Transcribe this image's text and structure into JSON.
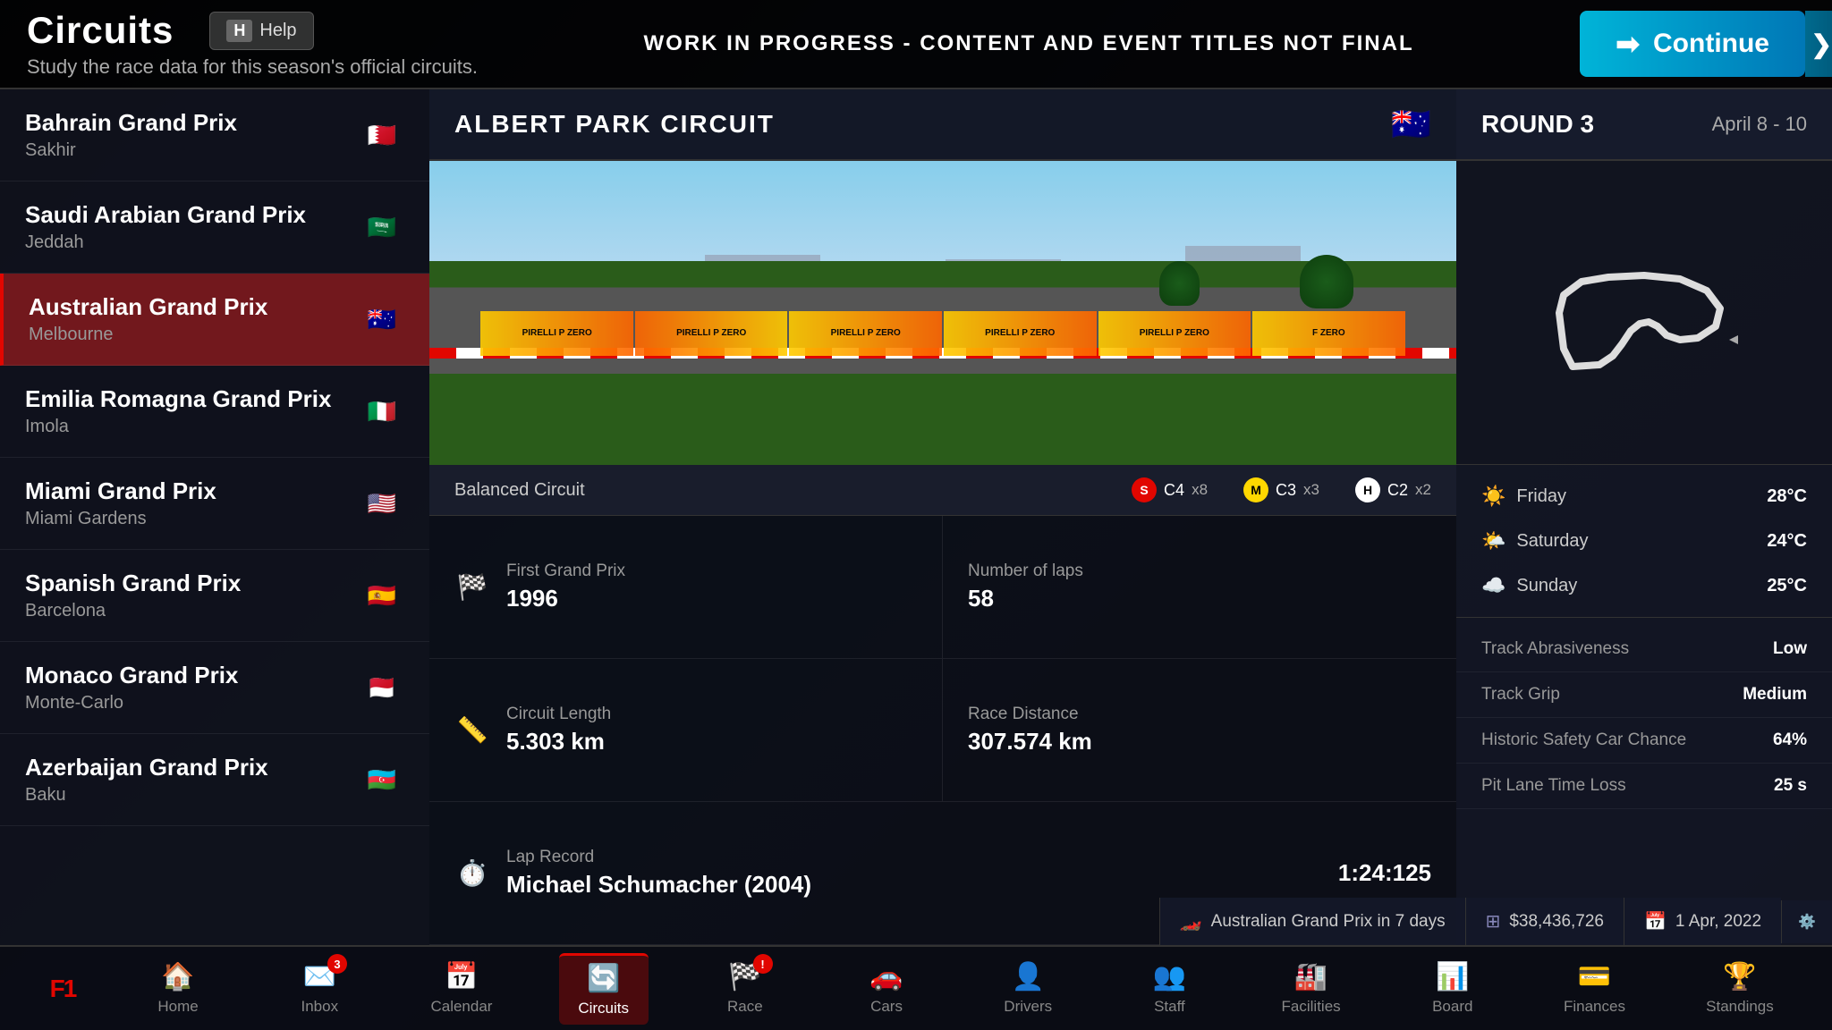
{
  "app": {
    "wip_banner": "WORK IN PROGRESS - CONTENT AND EVENT TITLES NOT FINAL"
  },
  "header": {
    "title": "Circuits",
    "subtitle": "Study the race data for this season's official circuits.",
    "help_label": "Help",
    "help_key": "H",
    "continue_label": "Continue"
  },
  "race_list": [
    {
      "id": "bahrain",
      "name": "Bahrain Grand Prix",
      "city": "Sakhir",
      "flag": "🇧🇭",
      "active": false
    },
    {
      "id": "saudi",
      "name": "Saudi Arabian Grand Prix",
      "city": "Jeddah",
      "flag": "🇸🇦",
      "active": false
    },
    {
      "id": "australia",
      "name": "Australian Grand Prix",
      "city": "Melbourne",
      "flag": "🇦🇺",
      "active": true
    },
    {
      "id": "emilia",
      "name": "Emilia Romagna Grand Prix",
      "city": "Imola",
      "flag": "🇮🇹",
      "active": false
    },
    {
      "id": "miami",
      "name": "Miami Grand Prix",
      "city": "Miami Gardens",
      "flag": "🇺🇸",
      "active": false
    },
    {
      "id": "spanish",
      "name": "Spanish Grand Prix",
      "city": "Barcelona",
      "flag": "🇪🇸",
      "active": false
    },
    {
      "id": "monaco",
      "name": "Monaco Grand Prix",
      "city": "Monte-Carlo",
      "flag": "🇲🇨",
      "active": false
    },
    {
      "id": "azerbaijan",
      "name": "Azerbaijan Grand Prix",
      "city": "Baku",
      "flag": "🇦🇿",
      "active": false
    }
  ],
  "circuit_detail": {
    "name": "ALBERT PARK CIRCUIT",
    "flag": "🇦🇺",
    "type": "Balanced Circuit",
    "tyres": {
      "soft": {
        "label": "S",
        "compound": "C4",
        "count": "x8"
      },
      "medium": {
        "label": "M",
        "compound": "C3",
        "count": "x3"
      },
      "hard": {
        "label": "H",
        "compound": "C2",
        "count": "x2"
      }
    },
    "first_grand_prix_label": "First Grand Prix",
    "first_grand_prix_value": "1996",
    "laps_label": "Number of laps",
    "laps_value": "58",
    "length_label": "Circuit Length",
    "length_value": "5.303 km",
    "distance_label": "Race Distance",
    "distance_value": "307.574 km",
    "lap_record_label": "Lap Record",
    "lap_record_holder": "Michael Schumacher (2004)",
    "lap_record_time": "1:24:125"
  },
  "round_info": {
    "label": "ROUND 3",
    "dates": "April 8 - 10"
  },
  "weather": [
    {
      "day": "Friday",
      "icon": "☀️",
      "temp": "28°C"
    },
    {
      "day": "Saturday",
      "icon": "🌤️",
      "temp": "24°C"
    },
    {
      "day": "Sunday",
      "icon": "☁️",
      "temp": "25°C"
    }
  ],
  "track_info": [
    {
      "label": "Track Abrasiveness",
      "value": "Low"
    },
    {
      "label": "Track Grip",
      "value": "Medium"
    },
    {
      "label": "Historic Safety Car Chance",
      "value": "64%"
    },
    {
      "label": "Pit Lane Time Loss",
      "value": "25 s"
    }
  ],
  "status_bar": [
    {
      "icon": "🏎️",
      "text": "Australian Grand Prix in 7 days"
    },
    {
      "icon": "💰",
      "text": "$38,436,726"
    },
    {
      "icon": "📅",
      "text": "1 Apr, 2022"
    }
  ],
  "nav": {
    "items": [
      {
        "id": "home",
        "label": "Home",
        "icon": "🏠",
        "active": false,
        "badge": null
      },
      {
        "id": "inbox",
        "label": "Inbox",
        "icon": "✉️",
        "active": false,
        "badge": "3"
      },
      {
        "id": "calendar",
        "label": "Calendar",
        "icon": "📅",
        "active": false,
        "badge": null
      },
      {
        "id": "circuits",
        "label": "Circuits",
        "icon": "🔄",
        "active": true,
        "badge": null
      },
      {
        "id": "race",
        "label": "Race",
        "icon": "🏁",
        "active": false,
        "badge": "!"
      },
      {
        "id": "cars",
        "label": "Cars",
        "icon": "🚗",
        "active": false,
        "badge": null
      },
      {
        "id": "drivers",
        "label": "Drivers",
        "icon": "👤",
        "active": false,
        "badge": null
      },
      {
        "id": "staff",
        "label": "Staff",
        "icon": "👥",
        "active": false,
        "badge": null
      },
      {
        "id": "facilities",
        "label": "Facilities",
        "icon": "🏭",
        "active": false,
        "badge": null
      },
      {
        "id": "board",
        "label": "Board",
        "icon": "📊",
        "active": false,
        "badge": null
      },
      {
        "id": "finances",
        "label": "Finances",
        "icon": "💳",
        "active": false,
        "badge": null
      },
      {
        "id": "standings",
        "label": "Standings",
        "icon": "🏆",
        "active": false,
        "badge": null
      }
    ]
  }
}
